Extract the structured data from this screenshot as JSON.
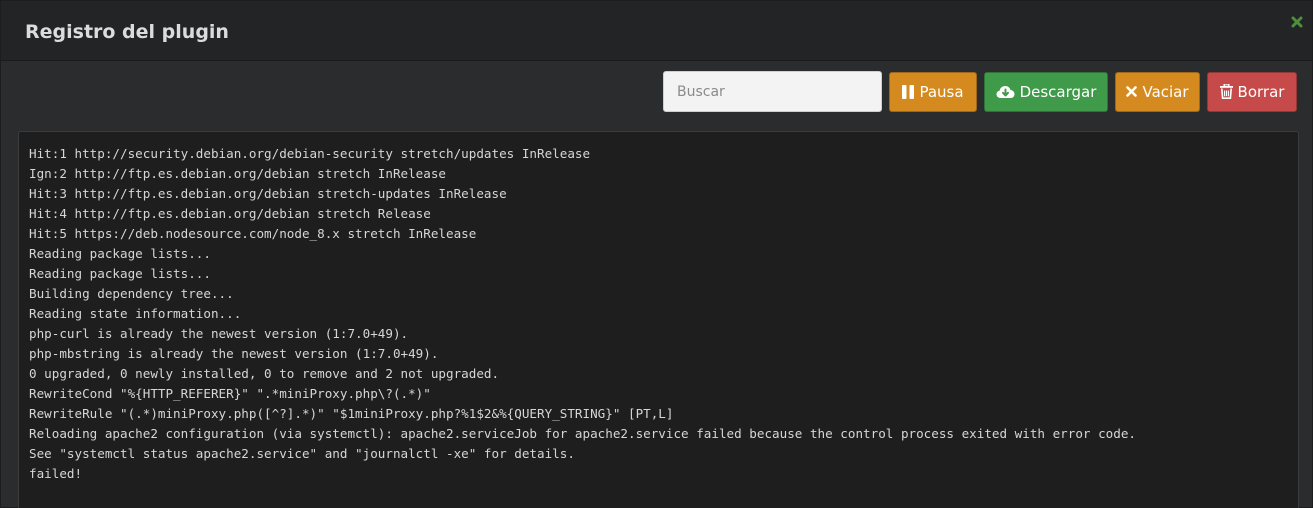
{
  "modal": {
    "title": "Registro del plugin",
    "close_icon": "close-x-icon",
    "colors": {
      "close": "#4d8f3a"
    }
  },
  "toolbar": {
    "search_placeholder": "Buscar",
    "search_value": "",
    "pause_label": "Pausa",
    "pause_icon": "pause-icon",
    "download_label": "Descargar",
    "download_icon": "cloud-download-icon",
    "clear_label": "Vaciar",
    "clear_icon": "times-icon",
    "delete_label": "Borrar",
    "delete_icon": "trash-icon",
    "colors": {
      "pause": "#d48a1f",
      "download": "#3f9a4a",
      "clear": "#d48a1f",
      "delete": "#c64a4a"
    }
  },
  "log": {
    "lines": [
      "Hit:1 http://security.debian.org/debian-security stretch/updates InRelease",
      "Ign:2 http://ftp.es.debian.org/debian stretch InRelease",
      "Hit:3 http://ftp.es.debian.org/debian stretch-updates InRelease",
      "Hit:4 http://ftp.es.debian.org/debian stretch Release",
      "Hit:5 https://deb.nodesource.com/node_8.x stretch InRelease",
      "Reading package lists...",
      "Reading package lists...",
      "Building dependency tree...",
      "Reading state information...",
      "php-curl is already the newest version (1:7.0+49).",
      "php-mbstring is already the newest version (1:7.0+49).",
      "0 upgraded, 0 newly installed, 0 to remove and 2 not upgraded.",
      "RewriteCond \"%{HTTP_REFERER}\" \".*miniProxy.php\\?(.*)\"",
      "RewriteRule \"(.*)miniProxy.php([^?].*)\" \"$1miniProxy.php?%1$2&%{QUERY_STRING}\" [PT,L]",
      "Reloading apache2 configuration (via systemctl): apache2.serviceJob for apache2.service failed because the control process exited with error code.",
      "See \"systemctl status apache2.service\" and \"journalctl -xe\" for details.",
      "failed!"
    ]
  }
}
